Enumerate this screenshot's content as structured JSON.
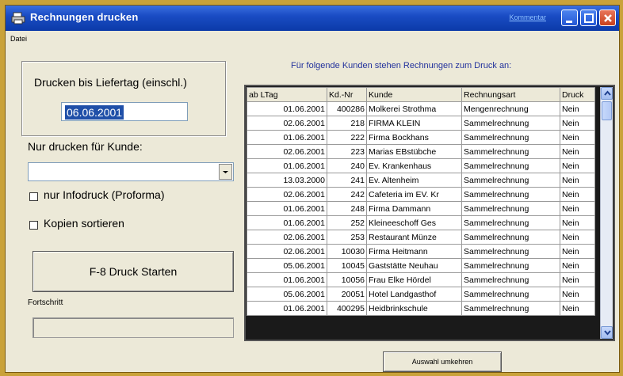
{
  "window": {
    "title": "Rechnungen drucken",
    "title_link": "Kommentar",
    "icon": "printer-icon"
  },
  "menu": {
    "items": [
      "Datei"
    ]
  },
  "left": {
    "date_label": "Drucken bis Liefertag (einschl.)",
    "date_value": "06.06.2001",
    "customer_label": "Nur drucken für Kunde:",
    "customer_value": "",
    "infodruck_label": "nur Infodruck (Proforma)",
    "infodruck_checked": false,
    "kopien_label": "Kopien sortieren",
    "kopien_checked": false,
    "start_button": "F-8 Druck Starten",
    "progress_label": "Fortschritt",
    "progress_value": 0
  },
  "grid": {
    "title": "Für folgende Kunden stehen Rechnungen zum Druck an:",
    "columns": [
      "ab LTag",
      "Kd.-Nr",
      "Kunde",
      "Rechnungsart",
      "Druck"
    ],
    "rows": [
      [
        "01.06.2001",
        "400286",
        "Molkerei Strothma",
        "Mengenrechnung",
        "Nein"
      ],
      [
        "02.06.2001",
        "218",
        "FIRMA KLEIN",
        "Sammelrechnung",
        "Nein"
      ],
      [
        "01.06.2001",
        "222",
        "Firma Bockhans",
        "Sammelrechnung",
        "Nein"
      ],
      [
        "02.06.2001",
        "223",
        "Marias EBstübche",
        "Sammelrechnung",
        "Nein"
      ],
      [
        "01.06.2001",
        "240",
        "Ev. Krankenhaus",
        "Sammelrechnung",
        "Nein"
      ],
      [
        "13.03.2000",
        "241",
        "Ev. Altenheim",
        "Sammelrechnung",
        "Nein"
      ],
      [
        "02.06.2001",
        "242",
        "Cafeteria im EV. Kr",
        "Sammelrechnung",
        "Nein"
      ],
      [
        "01.06.2001",
        "248",
        "Firma Dammann",
        "Sammelrechnung",
        "Nein"
      ],
      [
        "01.06.2001",
        "252",
        "Kleineeschoff Ges",
        "Sammelrechnung",
        "Nein"
      ],
      [
        "02.06.2001",
        "253",
        "Restaurant Münze",
        "Sammelrechnung",
        "Nein"
      ],
      [
        "02.06.2001",
        "10030",
        "Firma Heitmann",
        "Sammelrechnung",
        "Nein"
      ],
      [
        "05.06.2001",
        "10045",
        "Gaststätte Neuhau",
        "Sammelrechnung",
        "Nein"
      ],
      [
        "01.06.2001",
        "10056",
        "Frau  Elke Hördel",
        "Sammelrechnung",
        "Nein"
      ],
      [
        "05.06.2001",
        "20051",
        "Hotel Landgasthof",
        "Sammelrechnung",
        "Nein"
      ],
      [
        "01.06.2001",
        "400295",
        "Heidbrinkschule",
        "Sammelrechnung",
        "Nein"
      ]
    ]
  },
  "select_button": "Auswahl umkehren",
  "colors": {
    "titlebar": "#0b3aa8",
    "window_bg": "#ece9d8",
    "desktop": "#c9a23a",
    "selection": "#1f4fa8",
    "grid_title": "#23329c"
  }
}
